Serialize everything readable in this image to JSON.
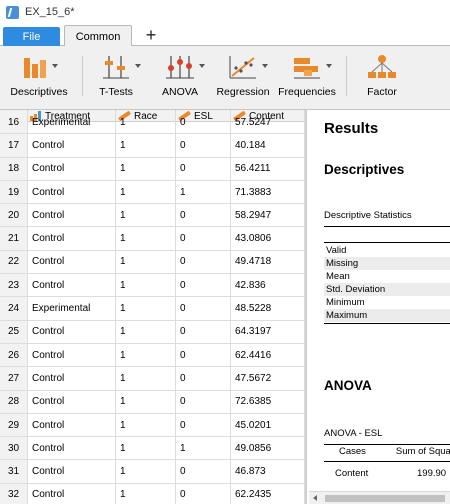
{
  "window": {
    "title": "EX_15_6*"
  },
  "tabs": {
    "file": "File",
    "common": "Common",
    "add": "+"
  },
  "ribbon": {
    "descriptives": "Descriptives",
    "ttests": "T-Tests",
    "anova": "ANOVA",
    "regression": "Regression",
    "frequencies": "Frequencies",
    "factor": "Factor"
  },
  "columns": [
    "Treatment",
    "Race",
    "ESL",
    "Content"
  ],
  "rows": [
    {
      "n": "16",
      "treatment": "Experimental",
      "race": "1",
      "esl": "0",
      "content": "57.5247"
    },
    {
      "n": "17",
      "treatment": "Control",
      "race": "1",
      "esl": "0",
      "content": "40.184"
    },
    {
      "n": "18",
      "treatment": "Control",
      "race": "1",
      "esl": "0",
      "content": "56.4211"
    },
    {
      "n": "19",
      "treatment": "Control",
      "race": "1",
      "esl": "1",
      "content": "71.3883"
    },
    {
      "n": "20",
      "treatment": "Control",
      "race": "1",
      "esl": "0",
      "content": "58.2947"
    },
    {
      "n": "21",
      "treatment": "Control",
      "race": "1",
      "esl": "0",
      "content": "43.0806"
    },
    {
      "n": "22",
      "treatment": "Control",
      "race": "1",
      "esl": "0",
      "content": "49.4718"
    },
    {
      "n": "23",
      "treatment": "Control",
      "race": "1",
      "esl": "0",
      "content": "42.836"
    },
    {
      "n": "24",
      "treatment": "Experimental",
      "race": "1",
      "esl": "0",
      "content": "48.5228"
    },
    {
      "n": "25",
      "treatment": "Control",
      "race": "1",
      "esl": "0",
      "content": "64.3197"
    },
    {
      "n": "26",
      "treatment": "Control",
      "race": "1",
      "esl": "0",
      "content": "62.4416"
    },
    {
      "n": "27",
      "treatment": "Control",
      "race": "1",
      "esl": "0",
      "content": "47.5672"
    },
    {
      "n": "28",
      "treatment": "Control",
      "race": "1",
      "esl": "0",
      "content": "72.6385"
    },
    {
      "n": "29",
      "treatment": "Control",
      "race": "1",
      "esl": "0",
      "content": "45.0201"
    },
    {
      "n": "30",
      "treatment": "Control",
      "race": "1",
      "esl": "1",
      "content": "49.0856"
    },
    {
      "n": "31",
      "treatment": "Control",
      "race": "1",
      "esl": "0",
      "content": "46.873"
    },
    {
      "n": "32",
      "treatment": "Control",
      "race": "1",
      "esl": "0",
      "content": "62.2435"
    }
  ],
  "results": {
    "title": "Results",
    "descriptives_heading": "Descriptives",
    "descriptive_statistics": "Descriptive Statistics",
    "stats": [
      "Valid",
      "Missing",
      "Mean",
      "Std. Deviation",
      "Minimum",
      "Maximum"
    ],
    "anova_heading": "ANOVA",
    "anova_table_title": "ANOVA - ESL",
    "anova_col_cases": "Cases",
    "anova_col_ss": "Sum of Squar",
    "anova_row_label": "Content",
    "anova_row_value": "199.90"
  },
  "colors": {
    "file_tab": "#2f8be0",
    "nominal_icon": "#e8892b",
    "ribbon_bg": "#f0f0f0"
  }
}
